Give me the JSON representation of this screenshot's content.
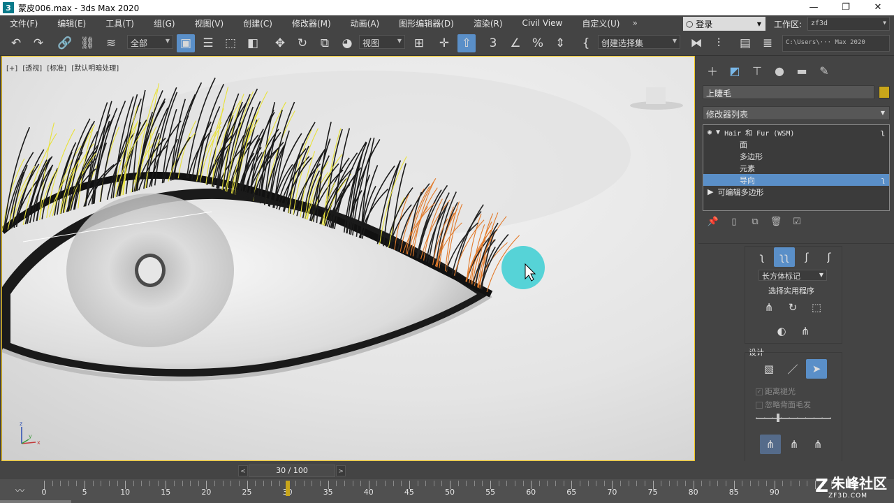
{
  "window": {
    "title": "蒙皮006.max - 3ds Max 2020",
    "app_icon": "3",
    "minimize": "—",
    "maximize": "❐",
    "close": "✕"
  },
  "menus": [
    "文件(F)",
    "编辑(E)",
    "工具(T)",
    "组(G)",
    "视图(V)",
    "创建(C)",
    "修改器(M)",
    "动画(A)",
    "图形编辑器(D)",
    "渲染(R)",
    "Civil View",
    "自定义(U)"
  ],
  "menu_more": "»",
  "login": {
    "label": "登录",
    "icon": "user-icon"
  },
  "workspace": {
    "label": "工作区:",
    "value": "zf3d"
  },
  "toolbar": {
    "selection_filter": "全部",
    "reference_coord": "视图",
    "named_selection": "创建选择集",
    "project_path": "C:\\Users\\··· Max 2020"
  },
  "viewport": {
    "labels": [
      "[+]",
      "[透视]",
      "[标准]",
      "[默认明暗处理]"
    ],
    "gizmo_axes": [
      "z",
      "y",
      "x"
    ]
  },
  "command_panel": {
    "object_name": "上睫毛",
    "object_color": "#c9a61a",
    "modifier_list": "修改器列表",
    "stack": {
      "top_modifier": "Hair 和 Fur (WSM)",
      "sub_items": [
        "面",
        "多边形",
        "元素",
        "导向"
      ],
      "selected_sub_item": "导向",
      "base_object": "可编辑多边形"
    },
    "guides_rollout": {
      "selection_type": "长方体标记",
      "selection_utilities": "选择实用程序"
    },
    "design": {
      "label": "设计",
      "option_1": "距离褪光",
      "option_2": "忽略背面毛发",
      "option_1_checked": true,
      "option_2_checked": false,
      "falloff_level": 0.3
    }
  },
  "timeline": {
    "current": "30 / 100",
    "prev": "<",
    "next": ">",
    "ticks": [
      "0",
      "5",
      "10",
      "15",
      "20",
      "25",
      "30",
      "35",
      "40",
      "45",
      "50",
      "55",
      "60",
      "65",
      "70",
      "75",
      "80",
      "85",
      "90"
    ],
    "current_frame": 30
  },
  "watermark": {
    "title": "朱峰社区",
    "url": "ZF3D.COM"
  }
}
